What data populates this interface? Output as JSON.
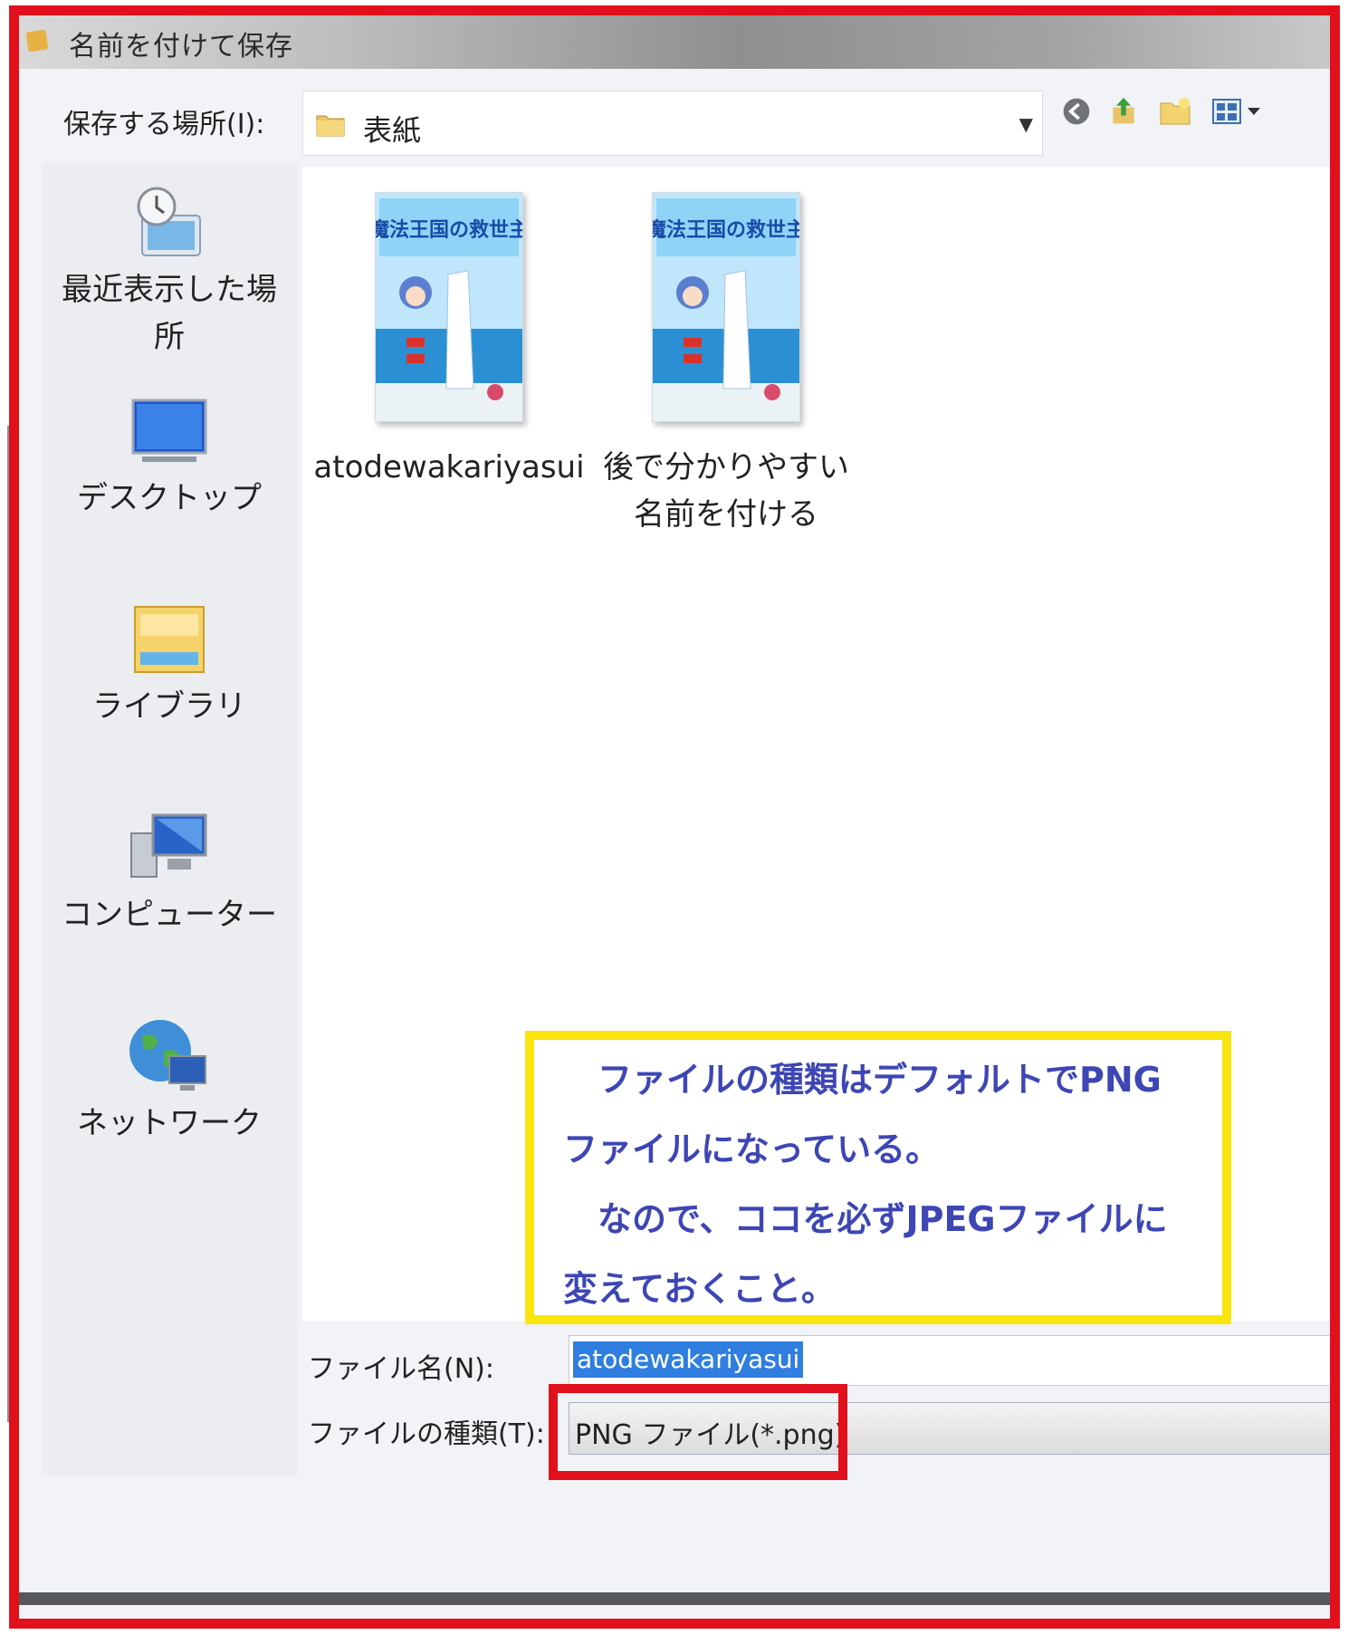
{
  "window": {
    "title": "名前を付けて保存"
  },
  "location": {
    "label": "保存する場所(I):",
    "current_folder": "表紙",
    "icons": [
      "back-icon",
      "up-folder-icon",
      "new-folder-icon",
      "view-menu-icon"
    ]
  },
  "places": [
    {
      "id": "recent",
      "label": "最近表示した場所",
      "icon": "recent-places-icon"
    },
    {
      "id": "desktop",
      "label": "デスクトップ",
      "icon": "desktop-icon"
    },
    {
      "id": "libraries",
      "label": "ライブラリ",
      "icon": "libraries-icon"
    },
    {
      "id": "computer",
      "label": "コンピューター",
      "icon": "computer-icon"
    },
    {
      "id": "network",
      "label": "ネットワーク",
      "icon": "network-icon"
    }
  ],
  "files": [
    {
      "name": "atodewakariyasui",
      "thumb_title": "魔法王国の救世主"
    },
    {
      "name": "後で分かりやすい名前を付ける",
      "thumb_title": "魔法王国の救世主"
    }
  ],
  "annotation": {
    "lines": [
      "ファイルの種類はデフォルトでPNG",
      "ファイルになっている。",
      "なので、ココを必ずJPEGファイルに",
      "変えておくこと。"
    ],
    "text_color": "#3d46b4",
    "border_color": "#fae60e"
  },
  "fields": {
    "filename_label": "ファイル名(N):",
    "filename_value": "atodewakariyasui",
    "filetype_label": "ファイルの種類(T):",
    "filetype_value": "PNG ファイル(*.png)"
  },
  "colors": {
    "highlight_red": "#e2101c",
    "selection_blue": "#2f7ee0"
  }
}
